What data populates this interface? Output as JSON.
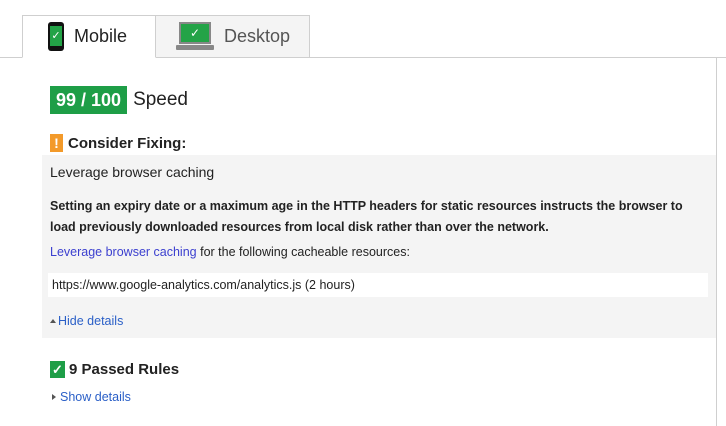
{
  "tabs": [
    {
      "label": "Mobile",
      "icon": "phone-icon",
      "active": true
    },
    {
      "label": "Desktop",
      "icon": "desktop-icon",
      "active": false
    }
  ],
  "score": {
    "value": "99 / 100",
    "label": "Speed",
    "color": "#1e9e47"
  },
  "consider": {
    "heading": "Consider Fixing:",
    "icon": "warning-icon",
    "rule_title": "Leverage browser caching",
    "description": "Setting an expiry date or a maximum age in the HTTP headers for static resources instructs the browser to load previously downloaded resources from local disk rather than over the network.",
    "resources_link": "Leverage browser caching",
    "resources_suffix": " for the following cacheable resources:",
    "resources": [
      "https://www.google-analytics.com/analytics.js (2 hours)"
    ],
    "hide_details": "Hide details",
    "accent_color": "#f39a2a"
  },
  "passed": {
    "heading": "9 Passed Rules",
    "icon": "check-icon",
    "show_details": "Show details"
  }
}
